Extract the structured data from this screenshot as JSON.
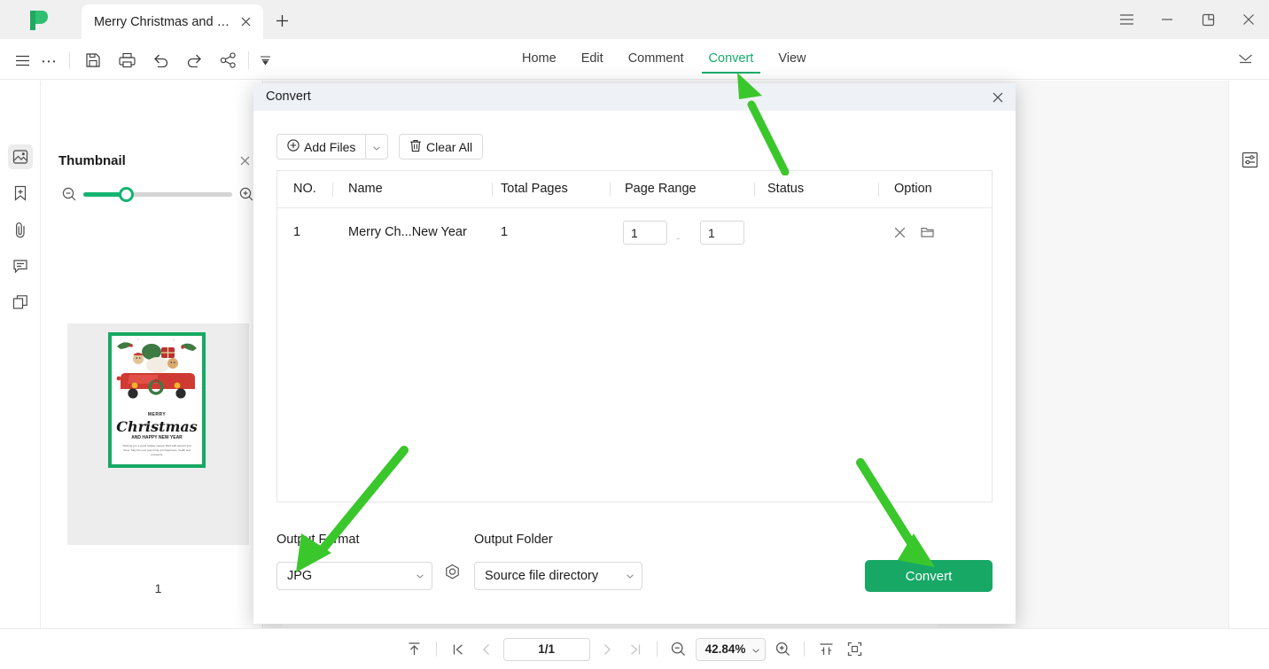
{
  "window": {
    "tab_title": "Merry Christmas and Ha...",
    "tab_close_icon": "close-icon",
    "new_tab_icon": "plus-icon",
    "controls": [
      "hamburger-menu-icon",
      "minimize-icon",
      "restore-icon",
      "close-icon"
    ]
  },
  "toolbar": {
    "icons": [
      "hamburger-icon",
      "more-icon",
      "save-icon",
      "print-icon",
      "undo-icon",
      "redo-icon",
      "share-icon",
      "customize-icon"
    ],
    "collapse_icon": "collapse-ribbon-icon"
  },
  "menu": {
    "items": [
      {
        "label": "Home",
        "active": false
      },
      {
        "label": "Edit",
        "active": false
      },
      {
        "label": "Comment",
        "active": false
      },
      {
        "label": "Convert",
        "active": true
      },
      {
        "label": "View",
        "active": false
      }
    ],
    "active_color": "#17ac6b"
  },
  "rail": {
    "items": [
      {
        "name": "thumbnail-panel",
        "icon": "thumbnail-icon",
        "selected": true
      },
      {
        "name": "bookmark-panel",
        "icon": "bookmark-plus-icon",
        "selected": false
      },
      {
        "name": "attachment-panel",
        "icon": "paperclip-icon",
        "selected": false
      },
      {
        "name": "comment-panel",
        "icon": "comment-icon",
        "selected": false
      },
      {
        "name": "stamp-panel",
        "icon": "layers-icon",
        "selected": false
      }
    ]
  },
  "thumbnail_panel": {
    "title": "Thumbnail",
    "close_icon": "close-icon",
    "zoom_out_icon": "zoom-out-icon",
    "zoom_in_icon": "zoom-in-icon",
    "page_label": "1",
    "card": {
      "line1": "MERRY",
      "line2": "Christmas",
      "line3": "AND HAPPY NEW YEAR",
      "line4": "Wishing you a joyful holiday season filled with warmth and cheer. May the new year bring you happiness, health and prosperity."
    }
  },
  "right_rail": {
    "icon": "properties-panel-icon"
  },
  "floating": {
    "word_badge_icon": "word-convert-icon"
  },
  "dialog": {
    "title": "Convert",
    "close_icon": "close-icon",
    "add_files_label": "Add Files",
    "add_files_icon": "plus-circle-icon",
    "add_files_caret": "chevron-down-icon",
    "clear_all_label": "Clear All",
    "clear_all_icon": "trash-icon",
    "columns": [
      "NO.",
      "Name",
      "Total Pages",
      "Page Range",
      "Status",
      "Option"
    ],
    "rows": [
      {
        "no": "1",
        "name": "Merry Ch...New Year",
        "total_pages": "1",
        "page_range_from": "1",
        "page_range_to": "1",
        "range_separator": "-",
        "status": "",
        "option_remove_icon": "close-icon",
        "option_folder_icon": "folder-icon"
      }
    ],
    "output_format_label": "Output Format",
    "output_format_value": "JPG",
    "settings_icon": "settings-gear-icon",
    "output_folder_label": "Output Folder",
    "output_folder_value": "Source file directory",
    "convert_label": "Convert",
    "convert_color": "#17a866"
  },
  "status_bar": {
    "scroll_top_icon": "scroll-to-top-icon",
    "first_page_icon": "first-page-icon",
    "prev_page_icon": "previous-page-icon",
    "page_value": "1/1",
    "next_page_icon": "next-page-icon",
    "last_page_icon": "last-page-icon",
    "zoom_out_icon": "zoom-out-icon",
    "zoom_value": "42.84%",
    "zoom_caret": "chevron-down-icon",
    "zoom_in_icon": "zoom-in-icon",
    "fit_width_icon": "fit-width-icon",
    "fit_page_icon": "fit-page-icon"
  },
  "annotations": {
    "arrow_color": "#3ac72b",
    "arrows": [
      {
        "name": "arrow-to-convert-tab",
        "target": "Convert menu tab"
      },
      {
        "name": "arrow-to-output-format",
        "target": "Output Format dropdown"
      },
      {
        "name": "arrow-to-convert-button",
        "target": "Convert button"
      }
    ]
  }
}
